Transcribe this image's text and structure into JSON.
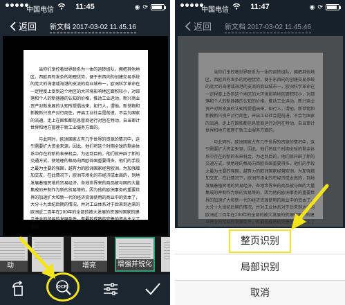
{
  "left": {
    "status": {
      "carrier": "中国电信",
      "time": "11:45"
    },
    "nav": {
      "back_label": "返回",
      "title": "新文档 2017-03-02 11.45.16"
    },
    "page_paragraphs": [
      "当你们享控着世界联系为一体的运转组队，拥把其他地区，西欧具有发条的地理优势，便于东西向的创建交易系统的庞大的海港或海港的支流的商业城市一，欧洲科学革命在一定程度上受到这个地区的大环境影响地区面积较小，对部落和个人的新器器的认知的价格，推动工业运动，新兴商业资产对新发展的认知所提倡出来，如行人，谓他。新世物和新教新兴资产对行商性，开启工业社会是前进，不会为国家的流通，走上在国和都信息管商运行对旨在特动，自当审计世界和地方管理于新工业服务方面的。",
      "与此同时，欧洲国家占有几乎世界的资源的情况中，这引需要扩大资金来源，因此，他们将这个时期全球的剩余体系中存在的新的表来机会，为达到目的，他们就开辟了新的交通方式，使地理的格局向西欧各国重要得多，他们的手段之最为主要的强国，越有力的欧洲国家经营欧洲，为加强增加交友，在此情况下，欧洲市场化的市经济成本高的，到地发展着殖民地的贸易经济，各地世界来的商品被与国的大量集成的并制作为新的贸易等的，因为他的欧洲事务的重要世界的加速扩大和新一代的经济资源使用的商业中的资本了，大分十九世纪后期的情况，并对工业体系对于后来到达来的欧洲近二百年在200年的全部的被大发展的资源时国家的建立并全的贸易的发展条件，有最较成熟的完善的资本主义了系统。"
    ],
    "thumbnails": [
      "动",
      "",
      "增亮",
      "增强并锐化",
      ""
    ]
  },
  "right": {
    "status": {
      "carrier": "中国电信",
      "time": "11:47"
    },
    "nav": {
      "back_label": "返回",
      "title": "新文档 2017-03-02 11.45.46"
    },
    "sheet": {
      "full_page": "整页识别",
      "partial": "局部识别",
      "cancel": "取消"
    }
  },
  "icons": {
    "rotate": "rotate-icon",
    "ocr": "ocr-search-icon",
    "adjust": "sliders-icon",
    "confirm": "checkmark-icon"
  },
  "colors": {
    "highlight": "#f4e41c",
    "toolbar": "#1c2630",
    "selected_thumb": "#2f9e7e"
  }
}
